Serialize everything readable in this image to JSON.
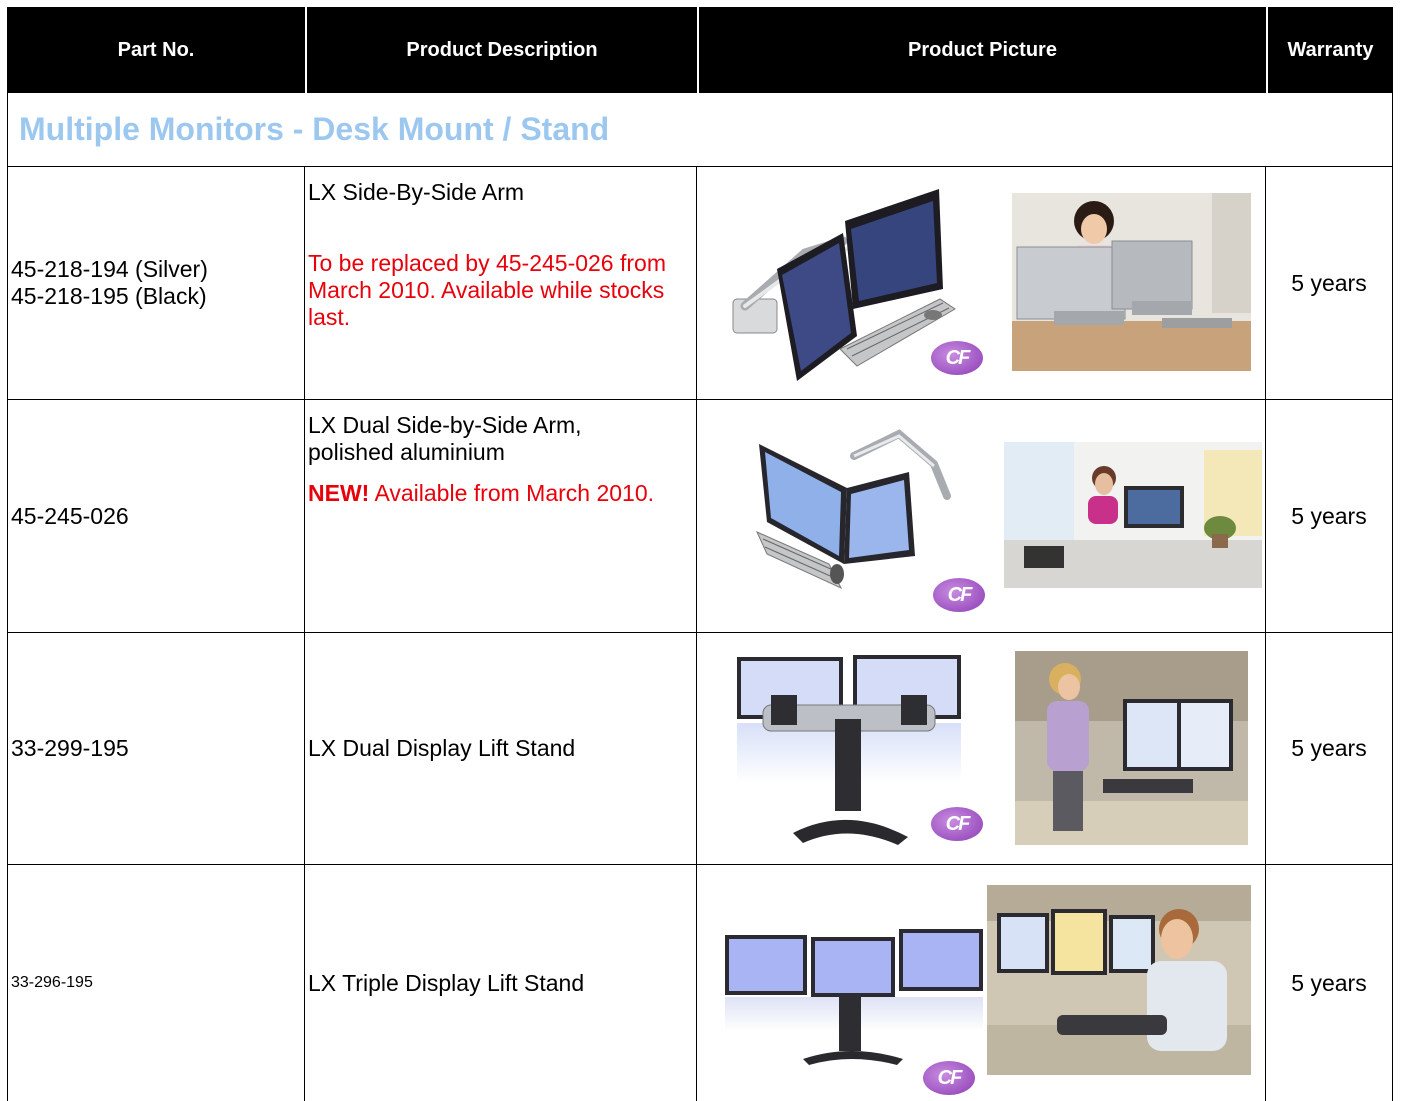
{
  "headers": {
    "part_no": "Part No.",
    "description": "Product Description",
    "picture": "Product Picture",
    "warranty": "Warranty"
  },
  "section_title": "Multiple Monitors - Desk Mount / Stand",
  "badge_label": "CF",
  "rows": [
    {
      "part_lines": [
        "45-218-194 (Silver)",
        "45-218-195 (Black)"
      ],
      "description": "LX Side-By-Side Arm",
      "note": "To be replaced by 45-245-026 from March 2010. Available while stocks last.",
      "warranty": "5 years",
      "picture": {
        "product_icon": "side-by-side-monitor-arm-image",
        "photo_icon": "woman-at-dual-monitors-photo"
      }
    },
    {
      "part_lines": [
        "45-245-026"
      ],
      "description": "LX Dual Side-by-Side Arm, polished aluminium",
      "note_bold": "NEW!",
      "note": "Available from March 2010.",
      "warranty": "5 years",
      "picture": {
        "product_icon": "dual-arm-monitors-image",
        "photo_icon": "woman-at-desk-photo"
      }
    },
    {
      "part_lines": [
        "33-299-195"
      ],
      "description": "LX Dual Display Lift Stand",
      "warranty": "5 years",
      "picture": {
        "product_icon": "dual-display-lift-stand-image",
        "photo_icon": "woman-standing-headset-photo"
      }
    },
    {
      "part_lines": [
        "33-296-195"
      ],
      "description": "LX Triple Display Lift Stand",
      "warranty": "5 years",
      "picture": {
        "product_icon": "triple-display-lift-stand-image",
        "photo_icon": "man-on-phone-photo"
      }
    }
  ],
  "colors": {
    "header_bg": "#000000",
    "header_text": "#ffffff",
    "section_title": "#9cc8f0",
    "note_red": "#e8000b",
    "badge": "#a050c8",
    "screen_blue": "#a8b4f4"
  }
}
